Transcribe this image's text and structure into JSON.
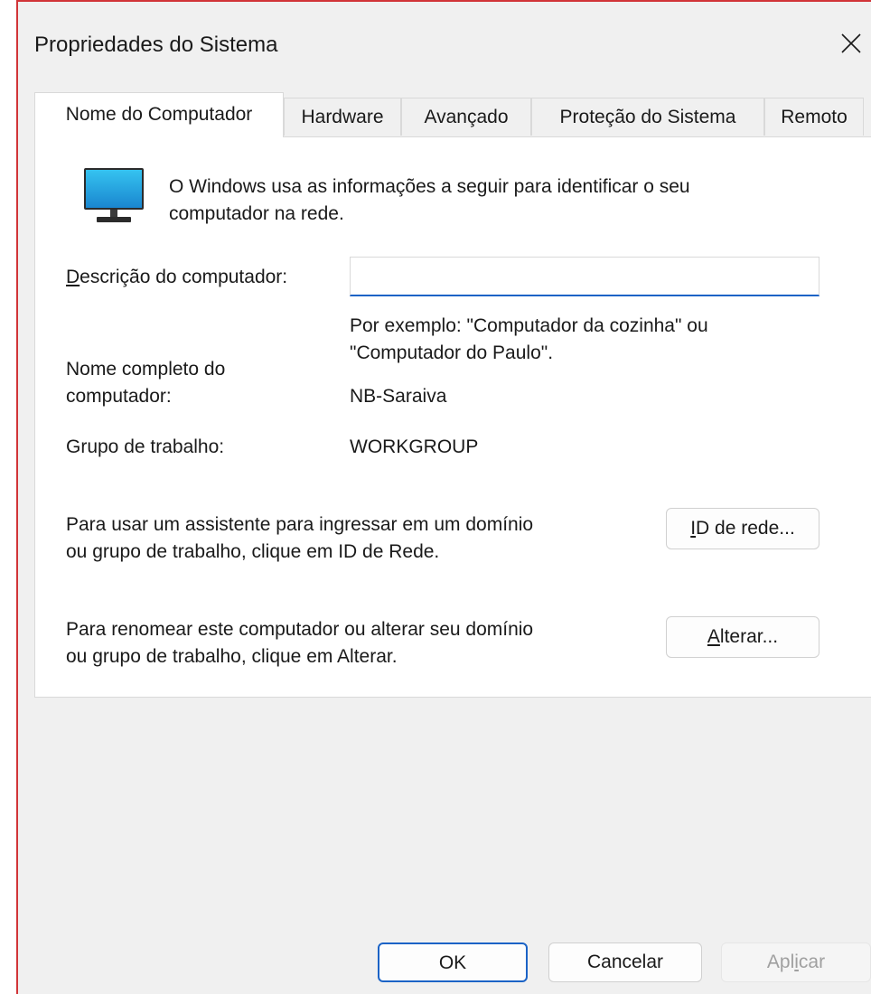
{
  "window": {
    "title": "Propriedades do Sistema",
    "close_icon": "close-icon",
    "accent_color": "#1b63c6",
    "border_color": "#d13438"
  },
  "tabs": [
    {
      "label": "Nome do Computador",
      "active": true
    },
    {
      "label": "Hardware",
      "active": false
    },
    {
      "label": "Avançado",
      "active": false
    },
    {
      "label": "Proteção do Sistema",
      "active": false
    },
    {
      "label": "Remoto",
      "active": false
    }
  ],
  "panel": {
    "icon": "computer-monitor-icon",
    "intro_line1": "O Windows usa as informações a seguir para identificar o seu",
    "intro_line2": "computador na rede.",
    "description": {
      "label_underlined": "D",
      "label_rest": "escrição do computador:",
      "value": "",
      "hint_line1": "Por exemplo: \"Computador da cozinha\" ou",
      "hint_line2": "\"Computador do Paulo\"."
    },
    "full_name": {
      "label_line1": "Nome completo do",
      "label_line2": "computador:",
      "value": "NB-Saraiva"
    },
    "workgroup": {
      "label": "Grupo de trabalho:",
      "value": "WORKGROUP"
    },
    "network_id": {
      "text_line1": "Para usar um assistente para ingressar em um domínio",
      "text_line2": "ou grupo de trabalho, clique em ID de Rede.",
      "button_underlined": "I",
      "button_rest": "D de rede..."
    },
    "rename": {
      "text_line1": "Para renomear este computador ou alterar seu domínio",
      "text_line2": "ou grupo de trabalho, clique em Alterar.",
      "button_underlined": "A",
      "button_rest": "lterar..."
    }
  },
  "footer": {
    "ok": "OK",
    "cancel": "Cancelar",
    "apply_pre": "Apl",
    "apply_underlined": "i",
    "apply_post": "car"
  }
}
